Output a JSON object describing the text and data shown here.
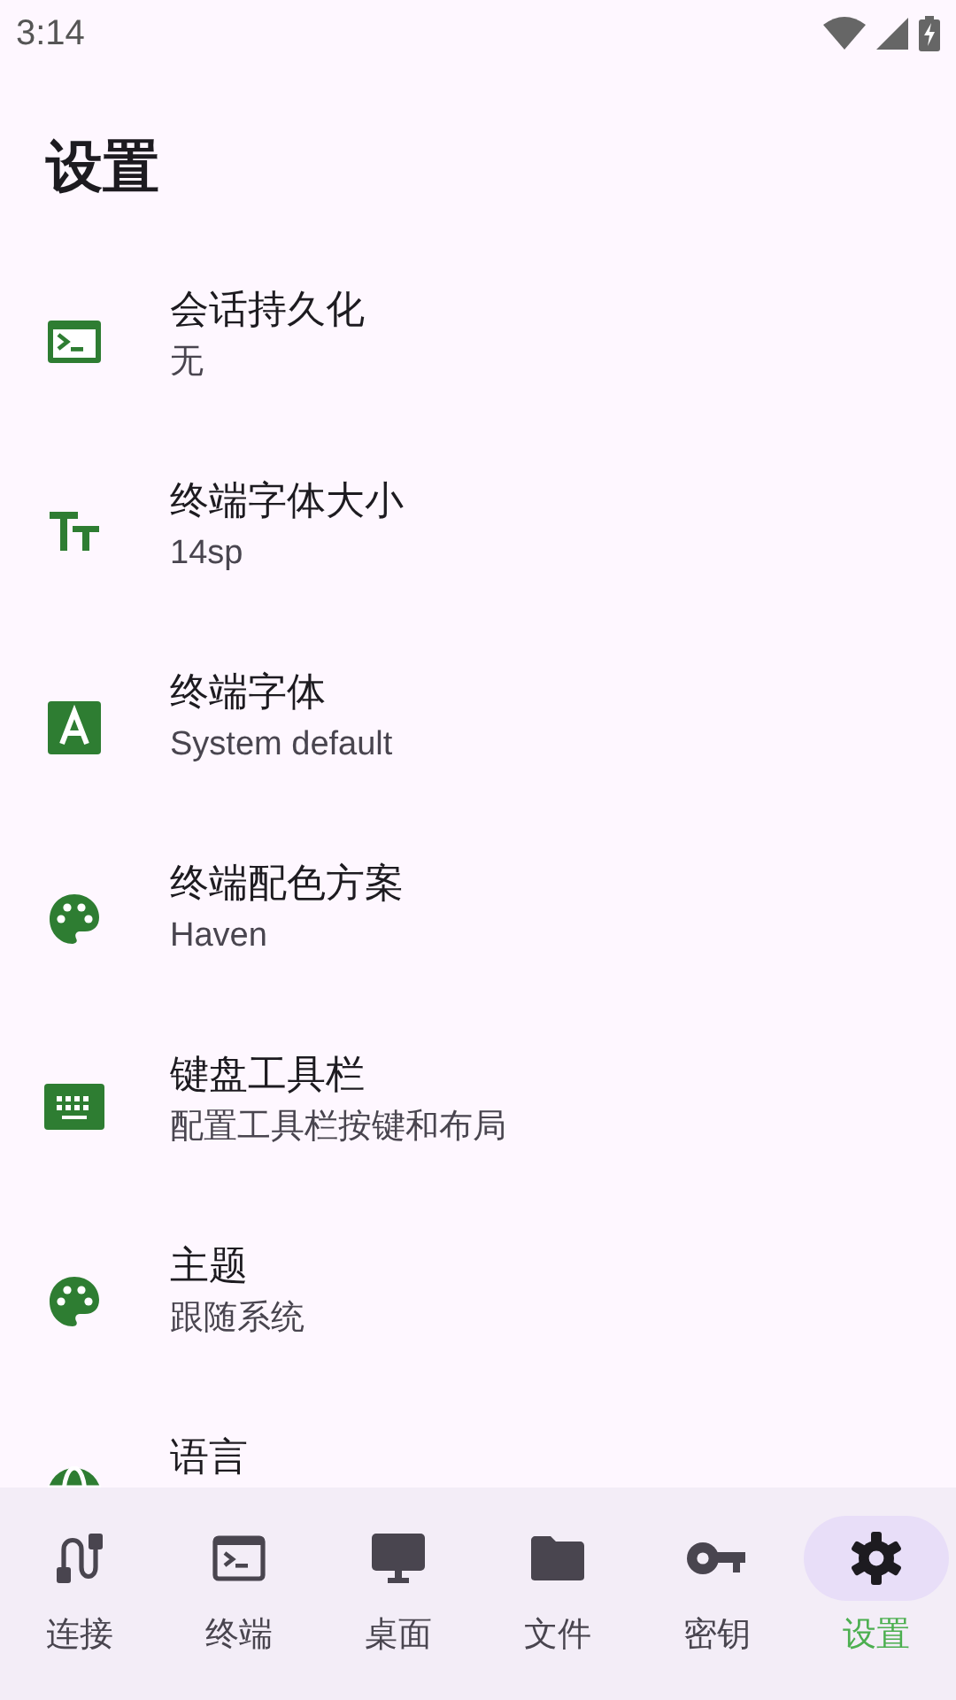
{
  "status_bar": {
    "time": "3:14"
  },
  "title": "设置",
  "settings": [
    {
      "title": "会话持久化",
      "subtitle": "无"
    },
    {
      "title": "终端字体大小",
      "subtitle": "14sp"
    },
    {
      "title": "终端字体",
      "subtitle": "System default"
    },
    {
      "title": "终端配色方案",
      "subtitle": "Haven"
    },
    {
      "title": "键盘工具栏",
      "subtitle": "配置工具栏按键和布局"
    },
    {
      "title": "主题",
      "subtitle": "跟随系统"
    },
    {
      "title": "语言"
    }
  ],
  "nav": [
    {
      "label": "连接",
      "selected": false
    },
    {
      "label": "终端",
      "selected": false
    },
    {
      "label": "桌面",
      "selected": false
    },
    {
      "label": "文件",
      "selected": false
    },
    {
      "label": "密钥",
      "selected": false
    },
    {
      "label": "设置",
      "selected": true
    }
  ]
}
